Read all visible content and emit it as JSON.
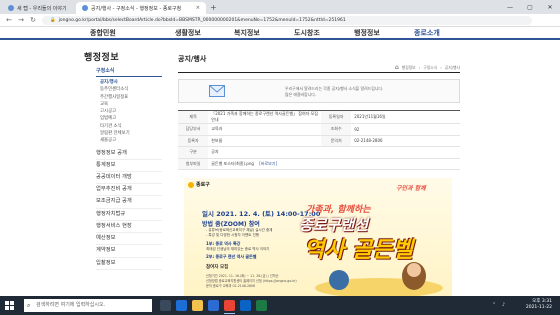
{
  "browser": {
    "tabs": [
      {
        "title": "새 탭 - 우리들의 이야기"
      },
      {
        "title": "공지/행사 - 구정소식 - 행정정보 - 종로구청",
        "close": "×"
      }
    ],
    "new_tab": "+",
    "window_controls": [
      "—",
      "▢",
      "✕"
    ],
    "url": "jongno.go.kr/portal/bbs/selectBoardArticle.do?bbsId=BBSMSTR_000000000201&menuNo=1752&menuId=1752&nttId=251961",
    "nav": [
      "←",
      "→",
      "↻"
    ]
  },
  "gnb": {
    "items": [
      "종합민원",
      "생활정보",
      "복지정보",
      "도시창조",
      "행정정보",
      "종로소개"
    ]
  },
  "lnb": {
    "title": "행정정보",
    "section": "구정소식",
    "sub_items": [
      "공지/행사",
      "동주민센터소식",
      "주간행사일정표",
      "교육",
      "고시공고",
      "입법예고",
      "타기관 소식",
      "알림판 전체보기",
      "새올공고"
    ],
    "main_items": [
      "행정정보 공개",
      "통계정보",
      "공공데이터 개방",
      "업무추진비 공개",
      "보조금지급 공개",
      "행정자치법규",
      "행정서비스 현장",
      "예산정보",
      "계약정보",
      "입찰정보"
    ]
  },
  "content": {
    "title": "공지/행사",
    "breadcrumbs": [
      "행정정보",
      "구정소식",
      "공지/행사"
    ],
    "notice_lines": [
      "우리구에서 알려드리는 각종 공지/행사 소식을 알려드립니다.",
      "많은 애용바랍니다."
    ],
    "info": {
      "title_label": "제목",
      "title_value": "「2021 가족과 함께하는 종로구랜선 역사골든벨」 참여자 모집 안내",
      "reg_date_label": "등록일자",
      "reg_date_value": "2021년11월16일",
      "dept_label": "담당부서",
      "dept_value": "교육과",
      "views_label": "조회수",
      "views_value": "92",
      "writer_label": "등록자",
      "writer_value": "한보름",
      "phone_label": "문의처",
      "phone_value": "02-2148-2806",
      "region_label": "구분",
      "region_value": "공지",
      "attach_label": "첨부파일",
      "attach_value": "골든벨 포스터(최종).png",
      "attach_action": "[바로보기]"
    }
  },
  "poster": {
    "org": "종로구",
    "slogan": "구민과 함께",
    "date_label": "일시",
    "date_value": "2021. 12. 4. (토) 14:00-17:00",
    "method_label": "방법",
    "method_value": "줌(ZOOM) 참여",
    "method_notes": [
      "- 유튜브(종로혁신교육지구 채널) 실시간 중계",
      "- 특강 및 다양한 시청자 이벤트 진행"
    ],
    "item1": "1부: 종로 역사 특강",
    "item1_note": "최태성 선생님의 재미있는 종로 역사 이야기",
    "item2": "2부: 종로구 랜선 역사 골든벨",
    "invite": "참여자 모집",
    "small_notes": [
      "신청기간 2021. 11. 16.(화) ~ 11. 26.(금) / 선착순",
      "신청방법 종로교육지원센터 홈페이지 신청 (https://jongno.go.kr)",
      "문의 종로구 교육과 02-2148-2806"
    ],
    "headline1": "가족과, 함께하는",
    "headline2": "종로구랜선",
    "headline3": "역사 골든벨"
  },
  "taskbar": {
    "search_placeholder": "검색하려면 여기에 입력하십시오.",
    "time": "오후 3:31",
    "date": "2021-11-22"
  },
  "colors": {
    "brand_blue": "#2f5597",
    "poster_red": "#e84c3d",
    "poster_gold": "#ffcc00"
  }
}
